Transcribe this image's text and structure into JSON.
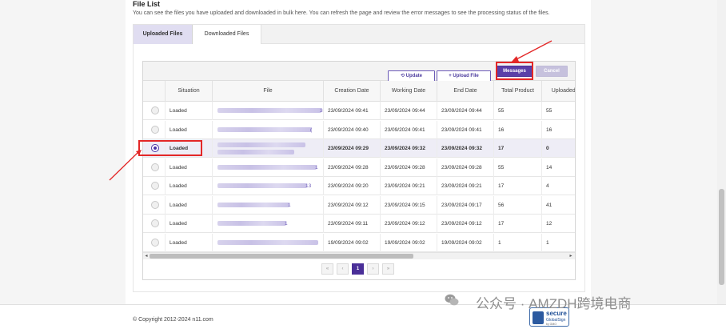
{
  "page": {
    "title": "File List",
    "description": "You can see the files you have uploaded and downloaded in bulk here. You can refresh the page and review the error messages to see the processing status of the files."
  },
  "tabs": [
    {
      "label": "Uploaded Files",
      "active": true
    },
    {
      "label": "Downloaded Files",
      "active": false
    }
  ],
  "toolbar": {
    "update_label": "Update",
    "upload_label": "Upload File",
    "messages_label": "Messages",
    "cancel_label": "Cancel"
  },
  "table": {
    "columns": [
      "",
      "Situation",
      "File",
      "Creation Date",
      "Working Date",
      "End Date",
      "Total Product",
      "Uploaded P"
    ],
    "rows": [
      {
        "selected": false,
        "situation": "Loaded",
        "file_hint": "39",
        "creation": "23/09/2024 09:41",
        "working": "23/09/2024 09:44",
        "end": "23/09/2024 09:44",
        "total": "55",
        "uploaded": "55"
      },
      {
        "selected": false,
        "situation": "Loaded",
        "file_hint": "(",
        "creation": "23/09/2024 09:40",
        "working": "23/09/2024 09:41",
        "end": "23/09/2024 09:41",
        "total": "16",
        "uploaded": "16"
      },
      {
        "selected": true,
        "situation": "Loaded",
        "file_hint": "",
        "creation": "23/09/2024 09:29",
        "working": "23/09/2024 09:32",
        "end": "23/09/2024 09:32",
        "total": "17",
        "uploaded": "0"
      },
      {
        "selected": false,
        "situation": "Loaded",
        "file_hint": "1",
        "creation": "23/09/2024 09:28",
        "working": "23/09/2024 09:28",
        "end": "23/09/2024 09:28",
        "total": "55",
        "uploaded": "14"
      },
      {
        "selected": false,
        "situation": "Loaded",
        "file_hint": "13",
        "creation": "23/09/2024 09:20",
        "working": "23/09/2024 09:21",
        "end": "23/09/2024 09:21",
        "total": "17",
        "uploaded": "4"
      },
      {
        "selected": false,
        "situation": "Loaded",
        "file_hint": "1",
        "creation": "23/09/2024 09:12",
        "working": "23/09/2024 09:15",
        "end": "23/09/2024 09:17",
        "total": "56",
        "uploaded": "41"
      },
      {
        "selected": false,
        "situation": "Loaded",
        "file_hint": "1",
        "creation": "23/09/2024 09:11",
        "working": "23/09/2024 09:12",
        "end": "23/09/2024 09:12",
        "total": "17",
        "uploaded": "12"
      },
      {
        "selected": false,
        "situation": "Loaded",
        "file_hint": "",
        "creation": "19/09/2024 09:02",
        "working": "19/09/2024 09:02",
        "end": "19/09/2024 09:02",
        "total": "1",
        "uploaded": "1"
      }
    ]
  },
  "pagination": {
    "first": "«",
    "prev": "‹",
    "current": "1",
    "next": "›",
    "last": "»"
  },
  "footer": {
    "copyright": "© Copyright 2012-2024 n11.com",
    "secure_title": "secure",
    "secure_brand": "GlobalSign",
    "secure_sub": "by GMO"
  },
  "watermark": {
    "text": "公众号 · AMZDH跨境电商"
  },
  "colors": {
    "accent": "#5a3fa8",
    "highlight": "#e32727",
    "tab_active": "#e0ddf1"
  }
}
